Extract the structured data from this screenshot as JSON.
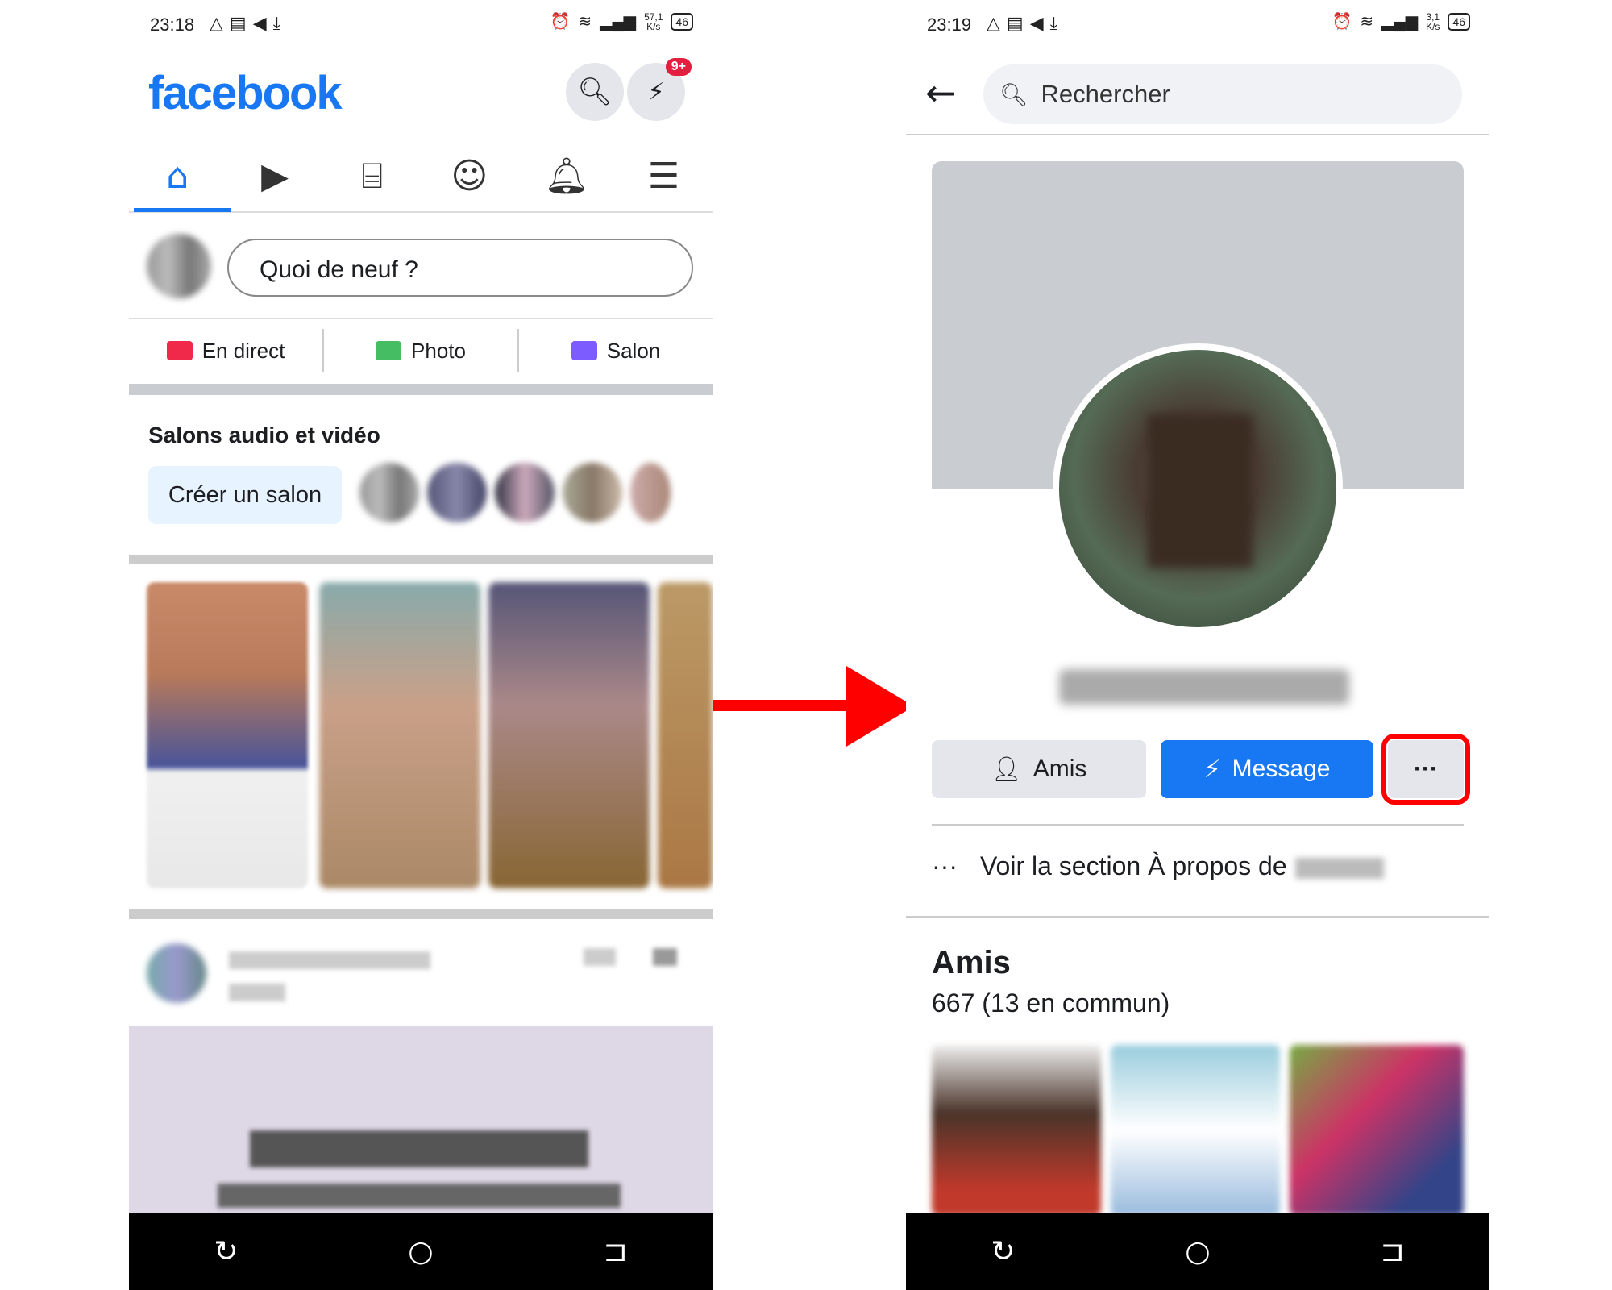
{
  "left": {
    "status": {
      "time": "23:18",
      "speed_value": "57,1",
      "speed_unit": "K/s",
      "battery": "46"
    },
    "logo": "facebook",
    "messenger_badge": "9+",
    "whats_new_placeholder": "Quoi de neuf ?",
    "actions": [
      {
        "label": "En direct",
        "icon": "live-icon",
        "color": "#f02849"
      },
      {
        "label": "Photo",
        "icon": "photo-icon",
        "color": "#45bd62"
      },
      {
        "label": "Salon",
        "icon": "room-icon",
        "color": "#7c5cff"
      }
    ],
    "rooms": {
      "title": "Salons audio et vidéo",
      "create_label": "Créer un salon"
    },
    "tabs": [
      "home-icon",
      "watch-icon",
      "marketplace-icon",
      "profile-icon",
      "notifications-icon",
      "menu-icon"
    ]
  },
  "right": {
    "status": {
      "time": "23:19",
      "speed_value": "3,1",
      "speed_unit": "K/s",
      "battery": "46"
    },
    "search_placeholder": "Rechercher",
    "buttons": {
      "friends": "Amis",
      "message": "Message",
      "more": "···"
    },
    "about_text": "Voir la section À propos de",
    "about_icon": "···",
    "friends_title": "Amis",
    "friends_count": "667 (13 en commun)"
  },
  "colors": {
    "accent": "#1877f2",
    "highlight": "#ff0000"
  }
}
